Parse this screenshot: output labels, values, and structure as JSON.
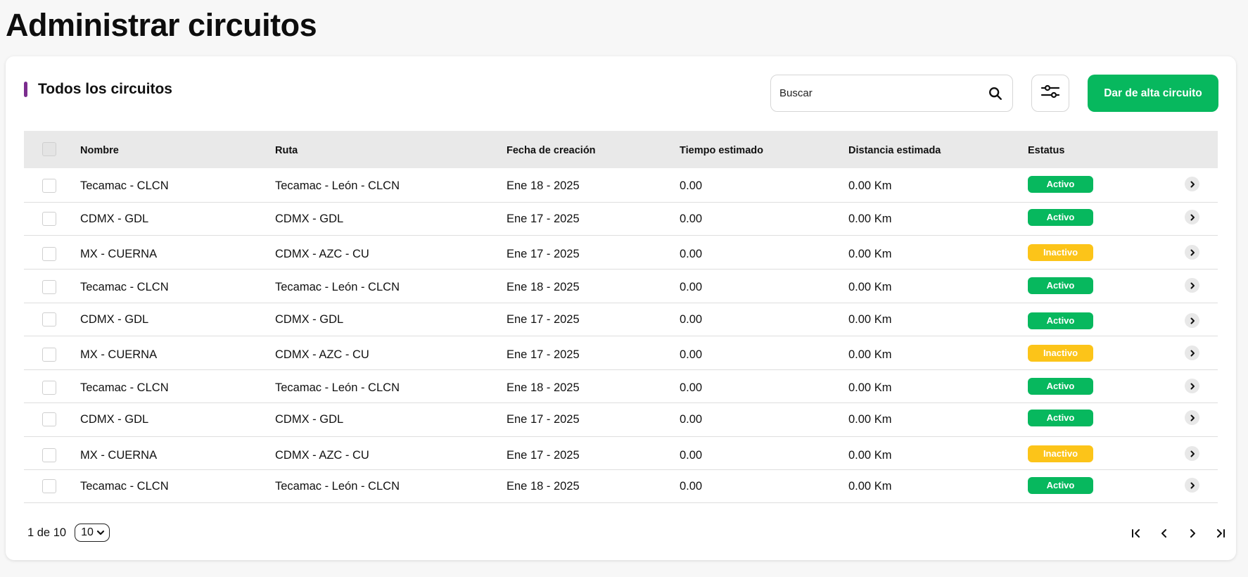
{
  "page": {
    "title": "Administrar circuitos"
  },
  "section": {
    "title": "Todos los circuitos"
  },
  "search": {
    "placeholder": "Buscar",
    "value": ""
  },
  "toolbar": {
    "add_label": "Dar de alta circuito"
  },
  "colors": {
    "accent": "#7b2d8e",
    "primary": "#07b85e",
    "active": "#07b85e",
    "inactive": "#fcc419"
  },
  "table": {
    "headers": {
      "nombre": "Nombre",
      "ruta": "Ruta",
      "fecha": "Fecha de creación",
      "tiempo": "Tiempo estimado",
      "distancia": "Distancia estimada",
      "estatus": "Estatus"
    },
    "rows": [
      {
        "nombre": "Tecamac - CLCN",
        "ruta": "Tecamac - León - CLCN",
        "fecha": "Ene 18 - 2025",
        "tiempo": "0.00",
        "distancia": "0.00 Km",
        "estatus": "Activo"
      },
      {
        "nombre": "CDMX - GDL",
        "ruta": "CDMX - GDL",
        "fecha": "Ene 17 - 2025",
        "tiempo": "0.00",
        "distancia": "0.00 Km",
        "estatus": "Activo"
      },
      {
        "nombre": "MX - CUERNA",
        "ruta": "CDMX - AZC - CU",
        "fecha": "Ene 17 - 2025",
        "tiempo": "0.00",
        "distancia": "0.00 Km",
        "estatus": "Inactivo"
      },
      {
        "nombre": "Tecamac - CLCN",
        "ruta": "Tecamac - León - CLCN",
        "fecha": "Ene 18 - 2025",
        "tiempo": "0.00",
        "distancia": "0.00 Km",
        "estatus": "Activo"
      },
      {
        "nombre": "CDMX - GDL",
        "ruta": "CDMX - GDL",
        "fecha": "Ene 17 - 2025",
        "tiempo": "0.00",
        "distancia": "0.00 Km",
        "estatus": "Activo"
      },
      {
        "nombre": "MX - CUERNA",
        "ruta": "CDMX - AZC - CU",
        "fecha": "Ene 17 - 2025",
        "tiempo": "0.00",
        "distancia": "0.00 Km",
        "estatus": "Inactivo"
      },
      {
        "nombre": "Tecamac - CLCN",
        "ruta": "Tecamac - León - CLCN",
        "fecha": "Ene 18 - 2025",
        "tiempo": "0.00",
        "distancia": "0.00 Km",
        "estatus": "Activo"
      },
      {
        "nombre": "CDMX - GDL",
        "ruta": "CDMX - GDL",
        "fecha": "Ene 17 - 2025",
        "tiempo": "0.00",
        "distancia": "0.00 Km",
        "estatus": "Activo"
      },
      {
        "nombre": "MX - CUERNA",
        "ruta": "CDMX - AZC - CU",
        "fecha": "Ene 17 - 2025",
        "tiempo": "0.00",
        "distancia": "0.00 Km",
        "estatus": "Inactivo"
      },
      {
        "nombre": "Tecamac - CLCN",
        "ruta": "Tecamac - León - CLCN",
        "fecha": "Ene 18 - 2025",
        "tiempo": "0.00",
        "distancia": "0.00 Km",
        "estatus": "Activo"
      }
    ]
  },
  "pagination": {
    "count_label": "1 de 10",
    "page_size": "10"
  },
  "icons": {
    "search": "search-icon",
    "filter": "sliders-icon",
    "row_action": "chevron-right-icon",
    "first": "first-page-icon",
    "prev": "chevron-left-icon",
    "next": "chevron-right-icon",
    "last": "last-page-icon"
  }
}
